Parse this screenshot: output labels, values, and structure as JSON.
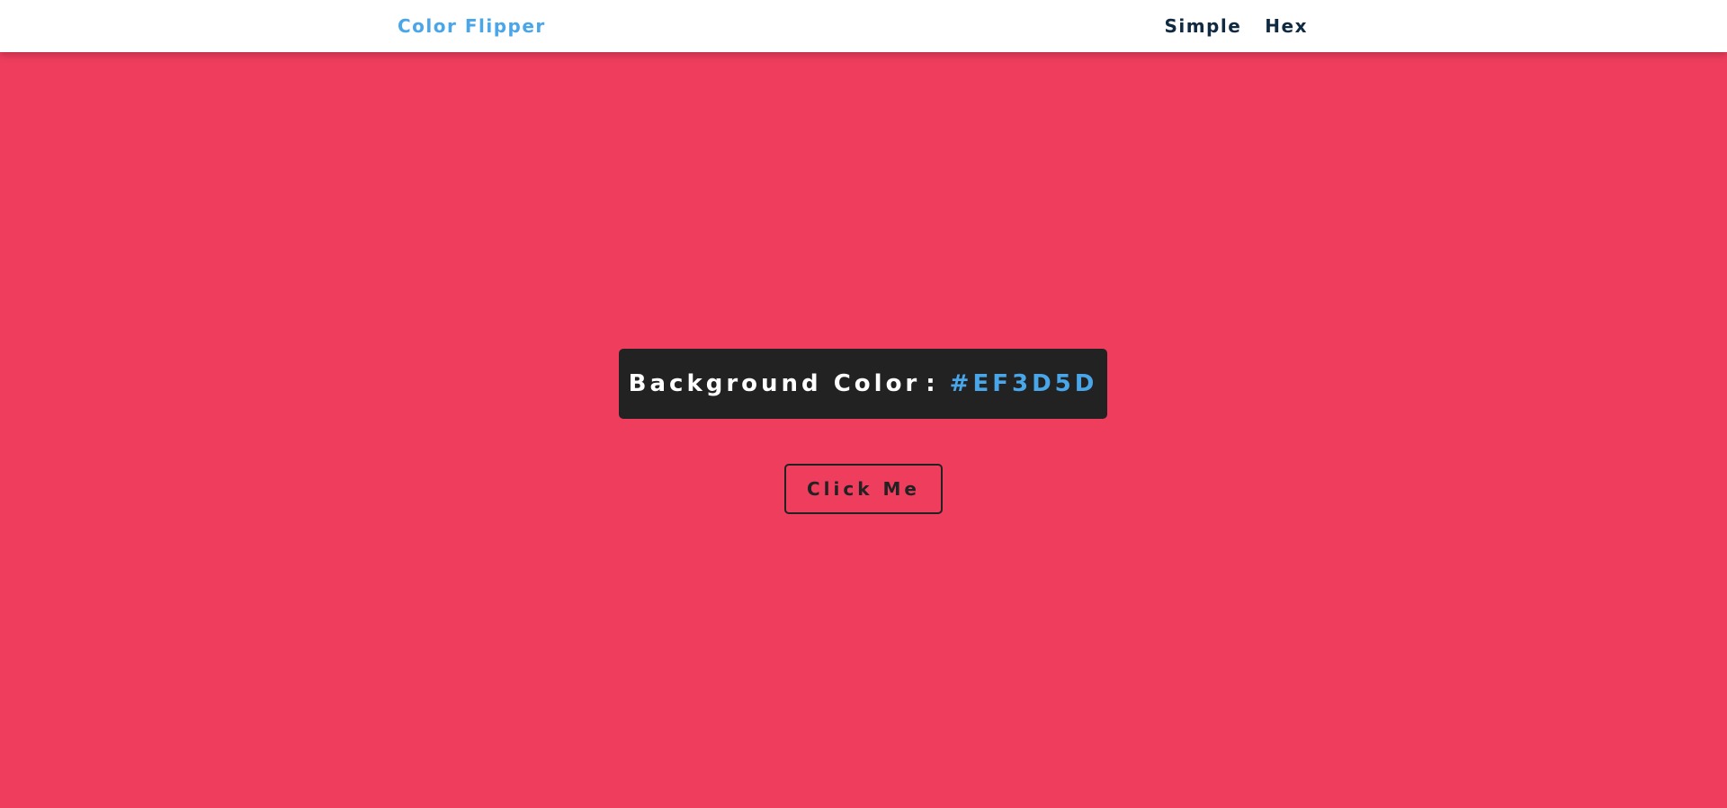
{
  "navbar": {
    "brand": "Color Flipper",
    "links": [
      {
        "label": "Simple"
      },
      {
        "label": "Hex"
      }
    ]
  },
  "main": {
    "color_label": "Background Color",
    "separator": ":",
    "color_value": "#EF3D5D",
    "button_label": "Click Me"
  },
  "colors": {
    "page_background": "#ef3d5d",
    "navbar_background": "#ffffff",
    "brand_accent": "#49a6e9",
    "nav_text": "#102a42",
    "box_background": "#222222",
    "box_text": "#ffffff",
    "button_border": "#222222"
  }
}
